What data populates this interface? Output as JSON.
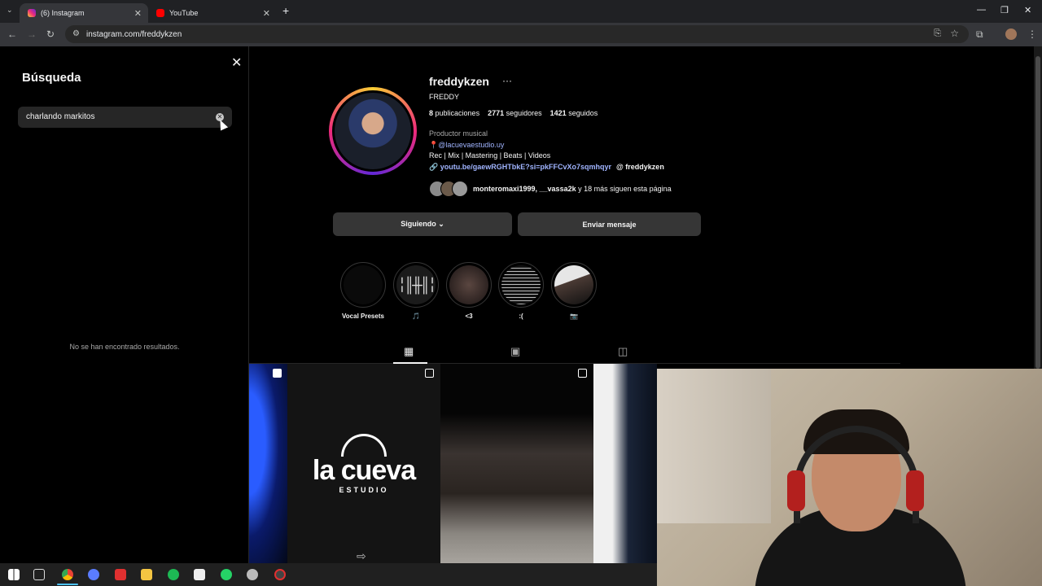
{
  "browser": {
    "tabs": [
      {
        "label": "(6) Instagram",
        "active": true
      },
      {
        "label": "YouTube",
        "active": false
      }
    ],
    "url": "instagram.com/freddykzen"
  },
  "search": {
    "title": "Búsqueda",
    "query": "charlando markitos",
    "no_results": "No se han encontrado resultados."
  },
  "profile": {
    "username": "freddykzen",
    "full_name": "FREDDY",
    "stats": [
      {
        "num": "8",
        "label": "publicaciones"
      },
      {
        "num": "2771",
        "label": "seguidores"
      },
      {
        "num": "1421",
        "label": "seguidos"
      }
    ],
    "category": "Productor musical",
    "mention": "📍@lacuevaestudio.uy",
    "bio": "Rec | Mix | Mastering | Beats | Videos",
    "link": "youtu.be/gaewRGHTbkE?si=pkFFCvXo7sqmhqyr",
    "threads": "freddykzen",
    "followed_by_names": "monteromaxi1999, __vassa2k",
    "followed_by_rest": "y 18 más siguen esta página",
    "following_button": "Siguiendo ⌄",
    "message_button": "Enviar mensaje"
  },
  "highlights": [
    {
      "label": "Vocal Presets"
    },
    {
      "label": "🎵"
    },
    {
      "label": "<3"
    },
    {
      "label": ":("
    },
    {
      "label": "📷"
    }
  ],
  "posts": {
    "cueva_title": "la cueva",
    "cueva_sub": "ESTUDIO"
  },
  "colors": {
    "accent_link": "#a0b4ff",
    "button_bg": "#363636"
  }
}
